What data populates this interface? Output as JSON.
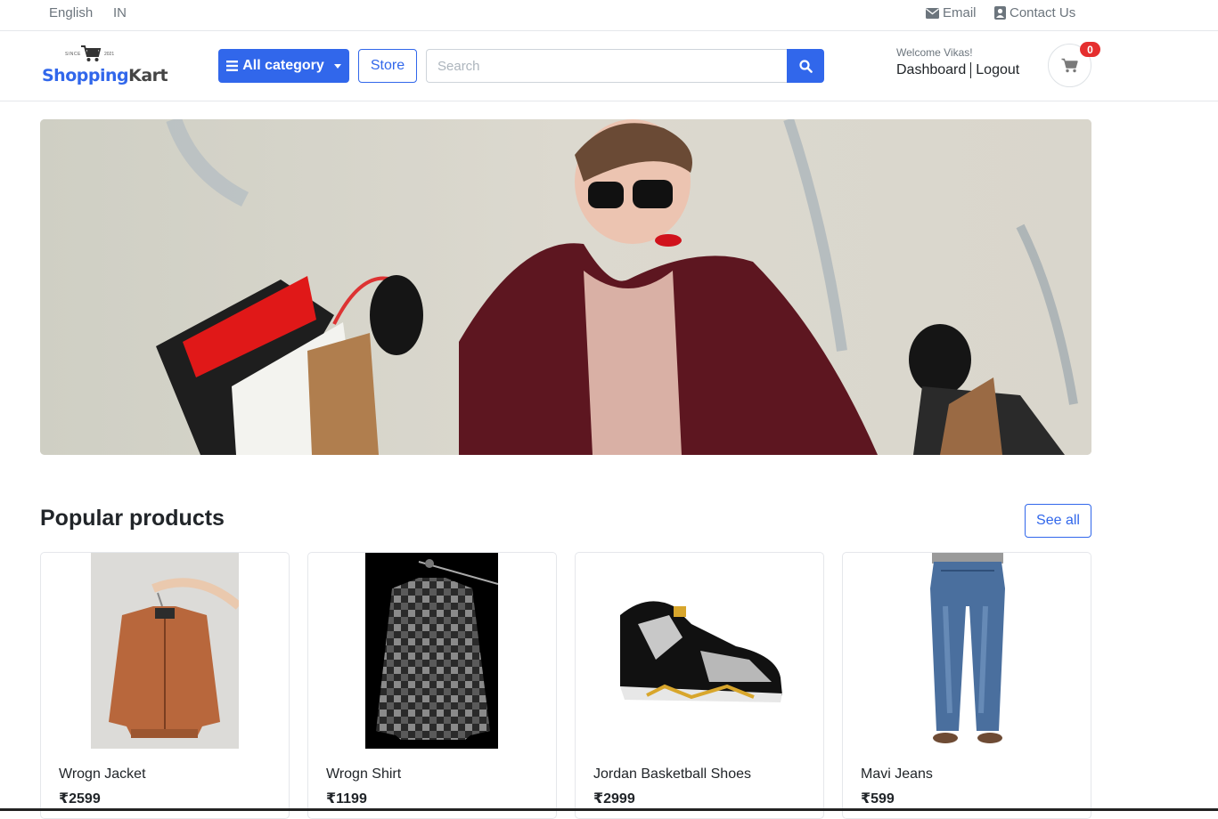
{
  "topbar": {
    "language": "English",
    "region": "IN",
    "email_label": "Email",
    "contact_label": "Contact Us"
  },
  "header": {
    "logo": {
      "since": "SINCE",
      "year": "2021",
      "brand_part1": "Shopping",
      "brand_part2": "Kart"
    },
    "category_label": "All category",
    "store_label": "Store",
    "search": {
      "placeholder": "Search",
      "value": ""
    },
    "welcome": "Welcome Vikas!",
    "dashboard_label": "Dashboard",
    "logout_label": "Logout",
    "cart_count": "0"
  },
  "hero": {
    "image": "woman-with-shopping-bags"
  },
  "popular": {
    "title": "Popular products",
    "see_all_label": "See all",
    "products": [
      {
        "name": "Wrogn Jacket",
        "price": "₹2599",
        "image": "brown-bomber-jacket"
      },
      {
        "name": "Wrogn Shirt",
        "price": "₹1199",
        "image": "checked-flannel-shirt"
      },
      {
        "name": "Jordan Basketball Shoes",
        "price": "₹2999",
        "image": "black-grey-sneaker"
      },
      {
        "name": "Mavi Jeans",
        "price": "₹599",
        "image": "blue-denim-jeans"
      }
    ]
  },
  "colors": {
    "primary": "#3167eb",
    "badge": "#e52e2e",
    "text": "#212529",
    "muted": "#6c757d"
  }
}
